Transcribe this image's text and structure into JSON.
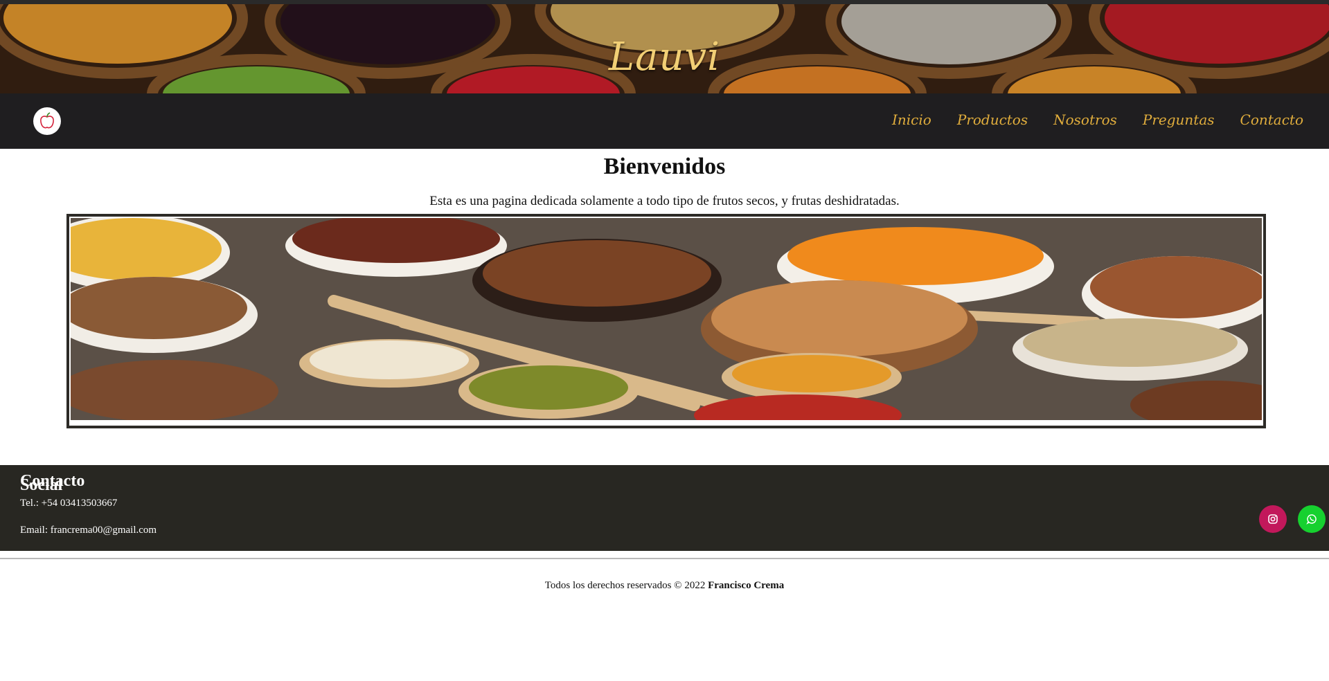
{
  "header": {
    "brand": "Lauvi"
  },
  "nav": {
    "items": [
      {
        "label": "Inicio"
      },
      {
        "label": "Productos"
      },
      {
        "label": "Nosotros"
      },
      {
        "label": "Preguntas"
      },
      {
        "label": "Contacto"
      }
    ]
  },
  "main": {
    "title": "Bienvenidos",
    "intro": "Esta es una pagina dedicada solamente a todo tipo de frutos secos, y frutas deshidratadas."
  },
  "footer": {
    "contact_title": "Contacto",
    "tel": "Tel.: +54 03413503667",
    "email": "Email: francrema00@gmail.com",
    "social_title": "Social",
    "social": [
      {
        "icon": "instagram-icon",
        "color": "#c2185b"
      },
      {
        "icon": "whatsapp-icon",
        "color": "#16d12f"
      }
    ]
  },
  "copyright": {
    "text": "Todos los derechos reservados © 2022 ",
    "author": "Francisco Crema"
  },
  "colors": {
    "nav_bg": "#1f1e20",
    "nav_link": "#e0ad3c",
    "brand": "#f2cf75",
    "footer_bg": "#282722"
  }
}
